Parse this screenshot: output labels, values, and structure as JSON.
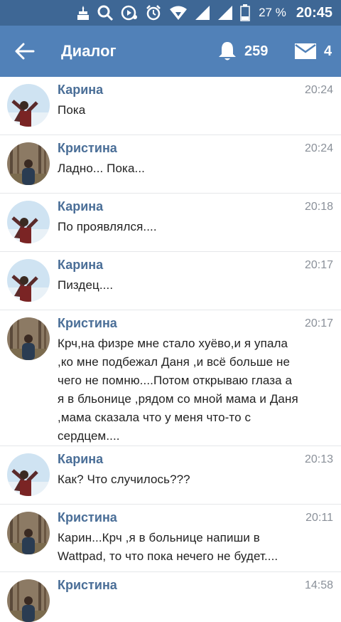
{
  "status_bar": {
    "battery_percent": "27 %",
    "clock": "20:45"
  },
  "toolbar": {
    "title": "Диалог",
    "notifications_count": "259",
    "messages_count": "4"
  },
  "messages": [
    {
      "name": "Карина",
      "time": "20:24",
      "text": "Пока",
      "avatar": "karina"
    },
    {
      "name": "Кристина",
      "time": "20:24",
      "text": "Ладно... Пока...",
      "avatar": "kristina"
    },
    {
      "name": "Карина",
      "time": "20:18",
      "text": "По проявлялся....",
      "avatar": "karina"
    },
    {
      "name": "Карина",
      "time": "20:17",
      "text": "Пиздец....",
      "avatar": "karina"
    },
    {
      "name": "Кристина",
      "time": "20:17",
      "text": "Крч,на физре мне стало хуёво,и я упала ,ко мне подбежал Даня ,и всё больше не чего не помню....Потом открываю глаза а я в бльонице ,рядом со мной мама и Даня ,мама сказала что у меня что-то с сердцем....",
      "avatar": "kristina"
    },
    {
      "name": "Карина",
      "time": "20:13",
      "text": "Как? Что случилось???",
      "avatar": "karina"
    },
    {
      "name": "Кристина",
      "time": "20:11",
      "text": "Карин...Крч ,я в больнице напиши в Wattpad, то что пока нечего не будет....",
      "avatar": "kristina"
    },
    {
      "name": "Кристина",
      "time": "14:58",
      "text": "",
      "avatar": "kristina"
    }
  ]
}
